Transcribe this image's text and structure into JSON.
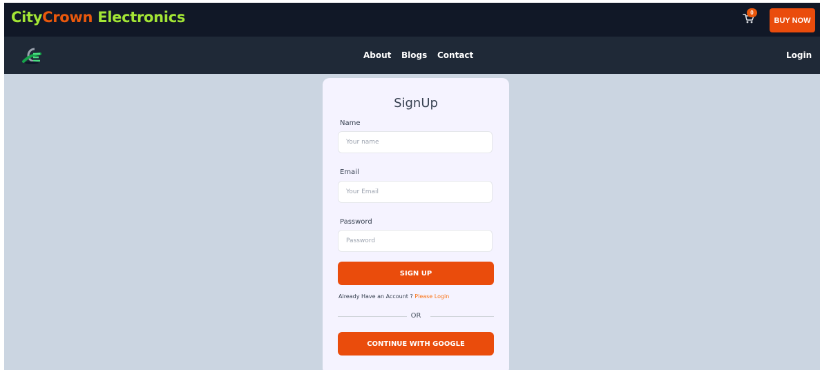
{
  "brand": {
    "part1": "City",
    "part2": "Crown",
    "part3": " Electronics"
  },
  "cart": {
    "count": "0"
  },
  "header": {
    "buy_now_label": "BUY NOW"
  },
  "nav": {
    "about": "About",
    "blogs": "Blogs",
    "contact": "Contact",
    "login": "Login"
  },
  "signup": {
    "title": "SignUp",
    "name_label": "Name",
    "name_placeholder": "Your name",
    "name_value": "",
    "email_label": "Email",
    "email_placeholder": "Your Email",
    "email_value": "",
    "password_label": "Password",
    "password_placeholder": "Password",
    "password_value": "",
    "submit_label": "SIGN UP",
    "account_text": "Already Have an Account ? ",
    "login_link": "Please Login",
    "or_text": "OR",
    "google_label": "CONTINUE WITH GOOGLE"
  },
  "colors": {
    "accent": "#ea4c0c",
    "brand_green": "#a3e635",
    "brand_orange": "#ea580c",
    "topbar": "#111827",
    "navbar": "#1f2937",
    "page_bg": "#cbd5e1",
    "card_bg": "#f5f3ff"
  },
  "icons": {
    "cart": "shopping-cart-icon",
    "logo": "cc-logo-icon"
  }
}
